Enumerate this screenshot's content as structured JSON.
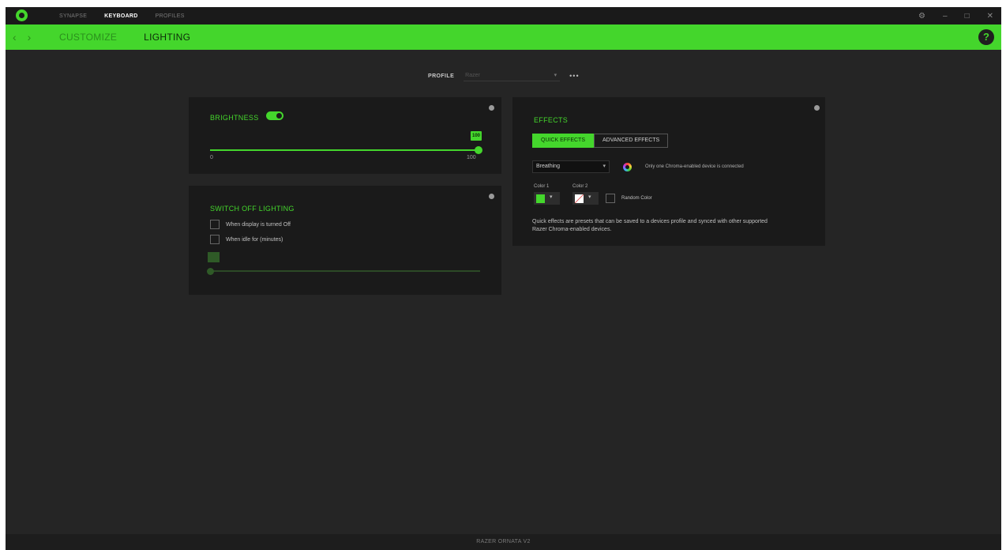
{
  "topnav": {
    "items": [
      "SYNAPSE",
      "KEYBOARD",
      "PROFILES"
    ],
    "active_index": 1
  },
  "window_controls": {
    "settings": "⚙",
    "minimize": "–",
    "maximize": "□",
    "close": "✕"
  },
  "subnav": {
    "back": "‹",
    "forward": "›",
    "tabs": [
      "CUSTOMIZE",
      "LIGHTING"
    ],
    "active_index": 1,
    "help": "?"
  },
  "profile": {
    "label": "PROFILE",
    "value": "Razer",
    "more": "•••"
  },
  "brightness": {
    "title": "BRIGHTNESS",
    "enabled": true,
    "value": 100,
    "value_label": "100",
    "min_label": "0",
    "max_label": "100"
  },
  "switch_off": {
    "title": "SWITCH OFF LIGHTING",
    "options": [
      {
        "label": "When display is turned Off",
        "checked": false
      },
      {
        "label": "When idle for (minutes)",
        "checked": false
      }
    ],
    "slider_value": 0
  },
  "effects": {
    "title": "EFFECTS",
    "tabs": [
      "QUICK EFFECTS",
      "ADVANCED EFFECTS"
    ],
    "active_tab": 0,
    "effect_value": "Breathing",
    "chroma_note": "Only one Chroma-enabled device is connected",
    "color1_label": "Color 1",
    "color2_label": "Color 2",
    "random_label": "Random Color",
    "description": "Quick effects are presets that can be saved to a devices profile and synced with other supported Razer Chroma-enabled devices."
  },
  "colors": {
    "accent": "#44d62c",
    "panel": "#1a1a1a",
    "background": "#252525",
    "color1": "#44d62c",
    "color2": "#ffffff"
  },
  "footer": {
    "device": "RAZER ORNATA V2"
  }
}
